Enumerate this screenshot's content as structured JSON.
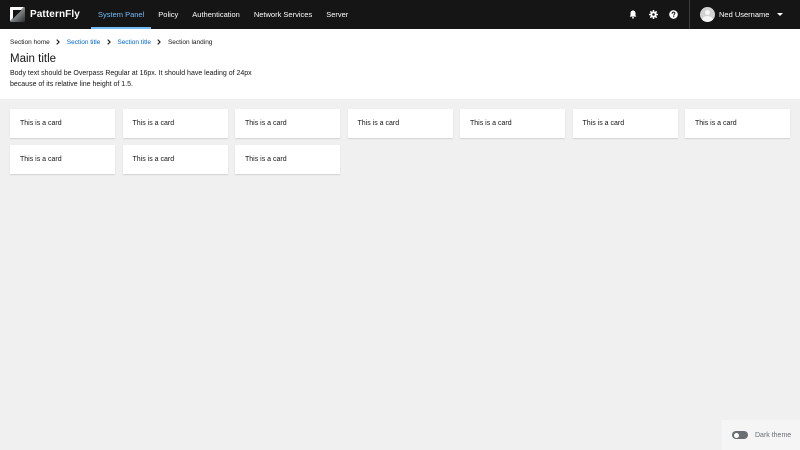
{
  "brand": {
    "name": "PatternFly"
  },
  "nav": {
    "items": [
      {
        "label": "System Panel",
        "active": true
      },
      {
        "label": "Policy",
        "active": false
      },
      {
        "label": "Authentication",
        "active": false
      },
      {
        "label": "Network Services",
        "active": false
      },
      {
        "label": "Server",
        "active": false
      }
    ]
  },
  "toolbar": {
    "icons": [
      "bell-icon",
      "gear-icon",
      "help-icon"
    ],
    "user_name": "Ned Username"
  },
  "breadcrumb": {
    "items": [
      {
        "label": "Section home",
        "link": false
      },
      {
        "label": "Section title",
        "link": true
      },
      {
        "label": "Section title",
        "link": true
      },
      {
        "label": "Section landing",
        "link": false
      }
    ]
  },
  "page": {
    "title": "Main title",
    "body": "Body text should be Overpass Regular at 16px. It should have leading of 24px because of its relative line height of 1.5."
  },
  "cards": [
    {
      "label": "This is a card"
    },
    {
      "label": "This is a card"
    },
    {
      "label": "This is a card"
    },
    {
      "label": "This is a card"
    },
    {
      "label": "This is a card"
    },
    {
      "label": "This is a card"
    },
    {
      "label": "This is a card"
    },
    {
      "label": "This is a card"
    },
    {
      "label": "This is a card"
    },
    {
      "label": "This is a card"
    }
  ],
  "theme_toggle": {
    "label": "Dark theme",
    "checked": false
  },
  "colors": {
    "masthead_bg": "#151515",
    "active_nav": "#73bcf7",
    "link": "#0066cc",
    "page_bg": "#f0f0f0"
  }
}
